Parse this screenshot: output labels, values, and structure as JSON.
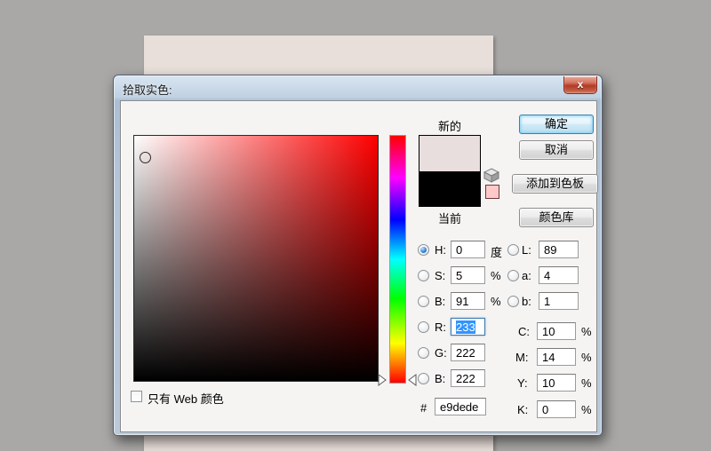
{
  "window": {
    "title": "拾取实色:",
    "close_glyph": "x"
  },
  "colors": {
    "paper": "#e9dfda",
    "new_color": "#e9dede",
    "current_color": "#000000",
    "websafe_color": "#ffc9c9",
    "hue": "#ff0000",
    "selection_blue": "#3194ff"
  },
  "picker": {
    "labels": {
      "new": "新的",
      "current": "当前"
    },
    "buttons": {
      "ok": "确定",
      "cancel": "取消",
      "add_to_swatches": "添加到色板",
      "color_libraries": "颜色库"
    },
    "web_only": {
      "label": "只有 Web 颜色",
      "checked": false
    },
    "hex": {
      "prefix": "#",
      "value": "e9dede"
    },
    "fields": {
      "h": {
        "label": "H:",
        "value": "0",
        "unit": "度",
        "selected_radio": true
      },
      "s": {
        "label": "S:",
        "value": "5",
        "unit": "%"
      },
      "b": {
        "label": "B:",
        "value": "91",
        "unit": "%"
      },
      "r": {
        "label": "R:",
        "value": "233"
      },
      "g": {
        "label": "G:",
        "value": "222"
      },
      "b2": {
        "label": "B:",
        "value": "222"
      },
      "l": {
        "label": "L:",
        "value": "89"
      },
      "a": {
        "label": "a:",
        "value": "4"
      },
      "lab_b": {
        "label": "b:",
        "value": "1"
      },
      "c": {
        "label": "C:",
        "value": "10",
        "unit": "%"
      },
      "m": {
        "label": "M:",
        "value": "14",
        "unit": "%"
      },
      "y": {
        "label": "Y:",
        "value": "10",
        "unit": "%"
      },
      "k": {
        "label": "K:",
        "value": "0",
        "unit": "%"
      }
    }
  }
}
